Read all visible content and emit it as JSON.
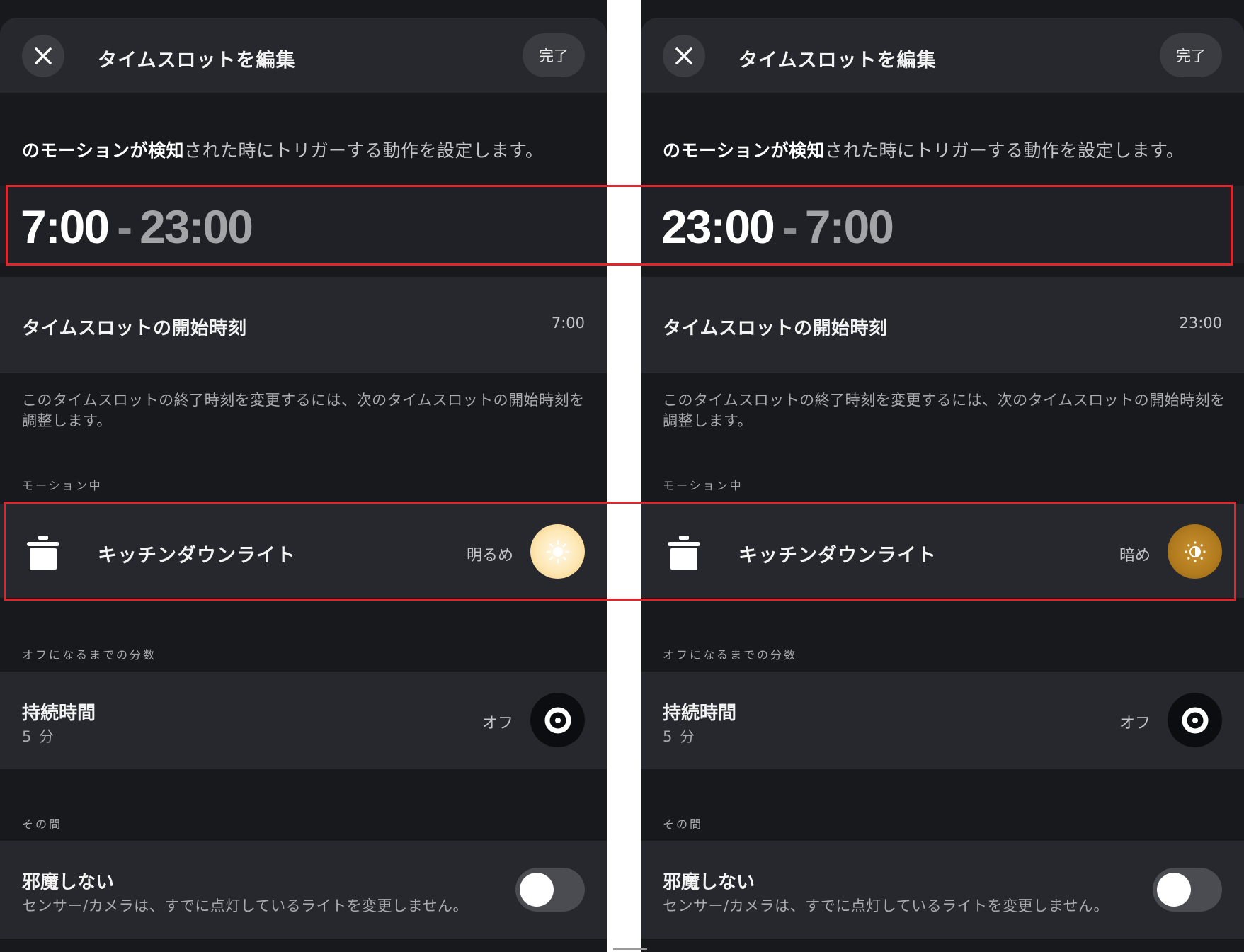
{
  "panels": {
    "left": {
      "header": {
        "title": "タイムスロットを編集",
        "done_label": "完了"
      },
      "intro": {
        "bold": "のモーションが検知",
        "rest": "された時にトリガーする動作を設定します。"
      },
      "time_range": {
        "start": "7:00",
        "dash": "-",
        "end": "23:00"
      },
      "start_row": {
        "label": "タイムスロットの開始時刻",
        "value": "7:00"
      },
      "note": "このタイムスロットの終了時刻を変更するには、次のタイムスロットの開始時刻を調整します。",
      "motion_section": "モーション中",
      "light": {
        "name": "キッチンダウンライト",
        "level": "明るめ",
        "level_icon": "sun-bright-icon"
      },
      "duration_section": "オフになるまでの分数",
      "duration": {
        "title": "持続時間",
        "sub": "5 分",
        "state": "オフ"
      },
      "meanwhile_section": "その間",
      "dnd": {
        "title": "邪魔しない",
        "sub": "センサー/カメラは、すでに点灯しているライトを変更しません。",
        "enabled": false
      }
    },
    "right": {
      "header": {
        "title": "タイムスロットを編集",
        "done_label": "完了"
      },
      "intro": {
        "bold": "のモーションが検知",
        "rest": "された時にトリガーする動作を設定します。"
      },
      "time_range": {
        "start": "23:00",
        "dash": "-",
        "end": "7:00"
      },
      "start_row": {
        "label": "タイムスロットの開始時刻",
        "value": "23:00"
      },
      "note": "このタイムスロットの終了時刻を変更するには、次のタイムスロットの開始時刻を調整します。",
      "motion_section": "モーション中",
      "light": {
        "name": "キッチンダウンライト",
        "level": "暗め",
        "level_icon": "sun-dim-icon"
      },
      "duration_section": "オフになるまでの分数",
      "duration": {
        "title": "持続時間",
        "sub": "5 分",
        "state": "オフ"
      },
      "meanwhile_section": "その間",
      "dnd": {
        "title": "邪魔しない",
        "sub": "センサー/カメラは、すでに点灯しているライトを変更しません。",
        "enabled": false
      }
    }
  },
  "colors": {
    "background": "#17191d",
    "row": "#26282d",
    "highlight": "#e0262d",
    "bright_button": "#fde7b4",
    "dim_button": "#b07a1e"
  }
}
